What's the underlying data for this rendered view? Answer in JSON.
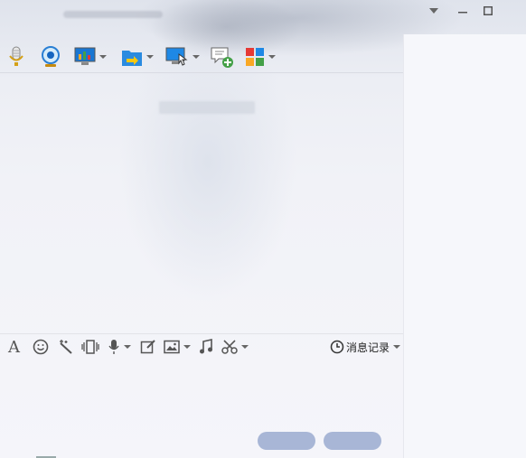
{
  "window": {
    "title": "",
    "controls": {
      "dropdown_icon": "chevron-down-icon",
      "minimize_icon": "minimize-icon",
      "maximize_icon": "maximize-icon"
    }
  },
  "toolbar": {
    "items": [
      {
        "name": "voice-call-button",
        "icon": "microphone-icon",
        "has_caret": false
      },
      {
        "name": "video-call-button",
        "icon": "webcam-icon",
        "has_caret": false
      },
      {
        "name": "remote-demo-button",
        "icon": "chart-monitor-icon",
        "has_caret": true
      },
      {
        "name": "send-file-button",
        "icon": "folder-transfer-icon",
        "has_caret": true
      },
      {
        "name": "remote-desktop-button",
        "icon": "screen-cursor-icon",
        "has_caret": true
      },
      {
        "name": "create-discussion-button",
        "icon": "chat-add-icon",
        "has_caret": false
      },
      {
        "name": "apps-button",
        "icon": "app-grid-icon",
        "has_caret": true
      }
    ]
  },
  "input_toolbar": {
    "items": [
      {
        "name": "font-button",
        "icon": "font-icon",
        "glyph": "A",
        "has_caret": false
      },
      {
        "name": "emoji-button",
        "icon": "smiley-icon",
        "glyph": "☺",
        "has_caret": false
      },
      {
        "name": "shake-button",
        "icon": "magic-wand-icon",
        "glyph": "✦",
        "has_caret": false
      },
      {
        "name": "window-shake-button",
        "icon": "vibrate-icon",
        "glyph": "▯",
        "has_caret": false
      },
      {
        "name": "voice-message-button",
        "icon": "microphone-icon",
        "glyph": "🎤",
        "has_caret": true
      },
      {
        "name": "doodle-button",
        "icon": "edit-icon",
        "glyph": "✎",
        "has_caret": false
      },
      {
        "name": "send-image-button",
        "icon": "image-icon",
        "glyph": "▣",
        "has_caret": true
      },
      {
        "name": "music-button",
        "icon": "music-note-icon",
        "glyph": "♫",
        "has_caret": false
      },
      {
        "name": "screenshot-button",
        "icon": "scissors-icon",
        "glyph": "✂",
        "has_caret": true
      }
    ],
    "history": {
      "icon": "clock-icon",
      "label": "消息记录"
    }
  },
  "buttons": {
    "close_label": "",
    "send_label": ""
  },
  "colors": {
    "button_bg": "#a8b6d6",
    "accent_blue": "#2a7fd4"
  }
}
